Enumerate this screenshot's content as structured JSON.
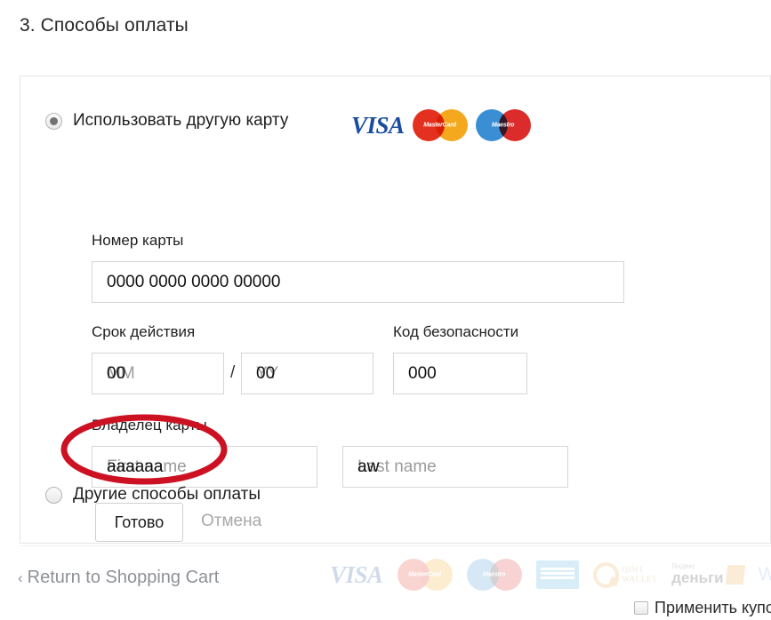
{
  "page": {
    "section_heading": "3. Способы оплаты"
  },
  "payment_panel": {
    "options": [
      {
        "id": "other-card",
        "label": "Использовать другую карту",
        "selected": true
      },
      {
        "id": "other-methods",
        "label": "Другие способы оплаты",
        "selected": false
      }
    ],
    "accepted_brands_top": [
      {
        "name": "visa-logo",
        "text": "VISA"
      },
      {
        "name": "mastercard-logo",
        "text": "MasterCard"
      },
      {
        "name": "maestro-logo",
        "text": "Maestro"
      }
    ],
    "accepted_brands_bottom": [
      {
        "name": "visa-logo",
        "text": "VISA"
      },
      {
        "name": "mastercard-logo",
        "text": "MasterCard"
      },
      {
        "name": "maestro-logo",
        "text": "Maestro"
      },
      {
        "name": "amex-logo",
        "text": "AMERICAN EXPRESS"
      },
      {
        "name": "qiwi-wallet-logo",
        "line1": "QIWI",
        "line2": "WALLET"
      },
      {
        "name": "yandex-money-logo",
        "line1": "Яндекс",
        "line2": "деньги"
      },
      {
        "name": "webmoney-logo",
        "text": "WebMoney"
      }
    ],
    "form": {
      "card_number": {
        "label": "Номер карты",
        "value": "0000 0000 0000 00000",
        "placeholder": "0000 0000 0000 0000"
      },
      "expiry": {
        "label": "Срок действия",
        "separator": "/",
        "month": {
          "placeholder": "MM",
          "value": "00"
        },
        "year": {
          "placeholder": "YY",
          "value": "00"
        }
      },
      "security_code": {
        "label": "Код безопасности",
        "value": "000",
        "placeholder": "000"
      },
      "card_holder": {
        "label": "Владелец карты",
        "first_name": {
          "placeholder": "First name",
          "value": "аааааа"
        },
        "last_name": {
          "placeholder": "Last name",
          "value": "aw"
        }
      }
    },
    "actions": {
      "done_label": "Готово",
      "cancel_label": "Отмена"
    }
  },
  "annotation": {
    "shape": "ellipse",
    "color": "#cc1122",
    "stroke_width": 7
  },
  "footer": {
    "return_link": "Return to Shopping Cart",
    "return_chevron": "‹",
    "coupon_label": "Применить купо"
  }
}
